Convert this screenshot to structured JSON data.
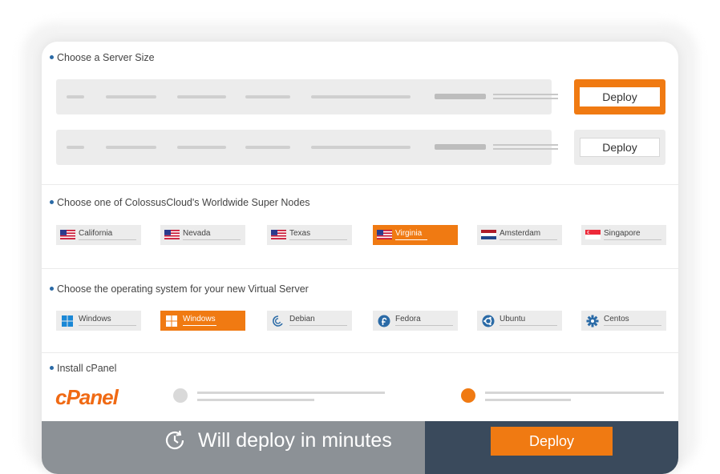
{
  "server_size": {
    "title": "Choose a Server Size",
    "rows": [
      {
        "deploy_label": "Deploy",
        "selected": true
      },
      {
        "deploy_label": "Deploy",
        "selected": false
      }
    ]
  },
  "nodes": {
    "title": "Choose one of ColossusCloud's Worldwide  Super Nodes",
    "items": [
      {
        "label": "California",
        "flag": "us-flag-icon"
      },
      {
        "label": "Nevada",
        "flag": "us-flag-icon"
      },
      {
        "label": "Texas",
        "flag": "us-flag-icon"
      },
      {
        "label": "Virginia",
        "flag": "us-flag-icon",
        "selected": true
      },
      {
        "label": "Amsterdam",
        "flag": "netherlands-flag-icon"
      },
      {
        "label": "Singapore",
        "flag": "singapore-flag-icon"
      }
    ]
  },
  "os": {
    "title": "Choose the operating system for your new Virtual Server",
    "items": [
      {
        "label": "Windows",
        "icon": "windows-icon"
      },
      {
        "label": "Windows",
        "icon": "windows-icon",
        "selected": true
      },
      {
        "label": "Debian",
        "icon": "debian-icon"
      },
      {
        "label": "Fedora",
        "icon": "fedora-icon"
      },
      {
        "label": "Ubuntu",
        "icon": "ubuntu-icon"
      },
      {
        "label": "Centos",
        "icon": "centos-icon"
      }
    ]
  },
  "cpanel": {
    "title": "Install cPanel",
    "logo_text": "cPanel",
    "selected_option": 2
  },
  "footer": {
    "message": "Will deploy in minutes",
    "deploy_label": "Deploy"
  },
  "colors": {
    "accent": "#f07a12",
    "footer_left": "#8c9196",
    "footer_right": "#3a4a5c"
  }
}
